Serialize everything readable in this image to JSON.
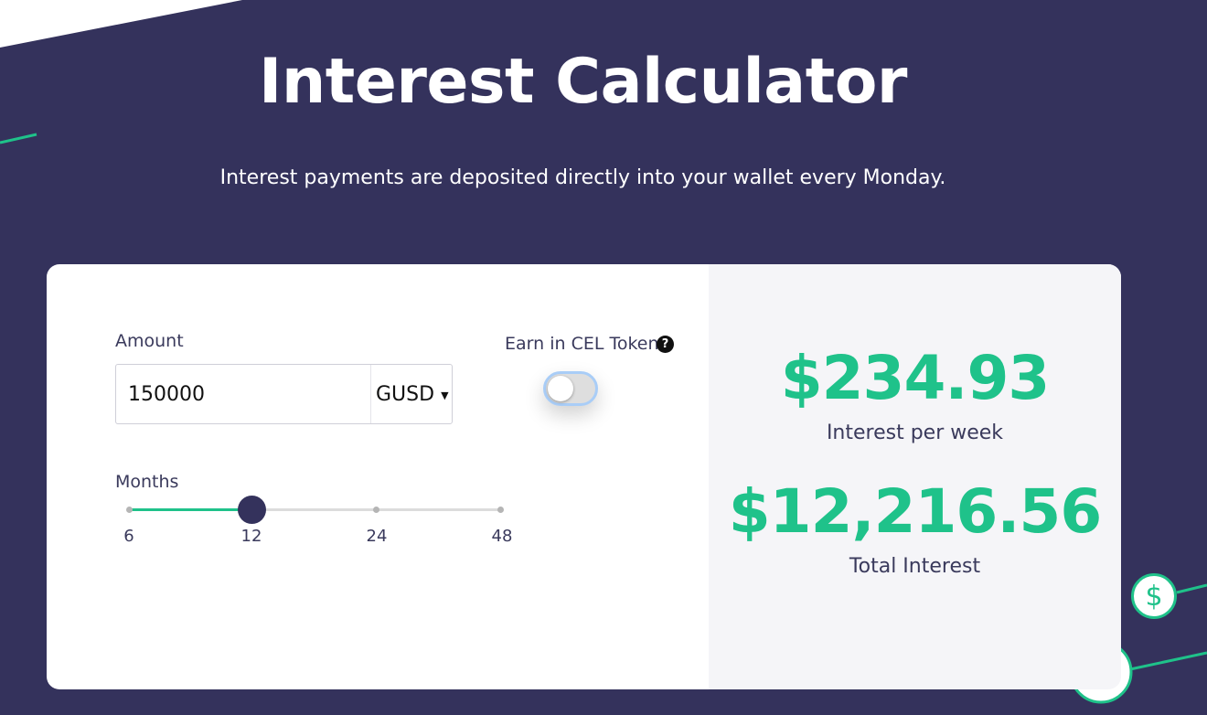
{
  "header": {
    "title": "Interest Calculator",
    "subtitle": "Interest payments are deposited directly into your wallet every Monday."
  },
  "calculator": {
    "amount_label": "Amount",
    "amount_value": "150000",
    "currency": "GUSD",
    "cel_label": "Earn in CEL Token",
    "help_glyph": "?",
    "cel_toggle_on": false,
    "months_label": "Months",
    "months_options": [
      "6",
      "12",
      "24",
      "48"
    ],
    "months_selected": "12"
  },
  "results": {
    "weekly_value": "$234.93",
    "weekly_label": "Interest per week",
    "total_value": "$12,216.56",
    "total_label": "Total Interest"
  },
  "decor": {
    "dollar_symbol": "$"
  },
  "colors": {
    "background": "#34325c",
    "accent": "#1fc28a",
    "card": "#ffffff",
    "results_panel": "#f5f5f8"
  },
  "icons": [
    "help-icon",
    "dollar-coin-icon",
    "dropdown-caret-icon"
  ]
}
